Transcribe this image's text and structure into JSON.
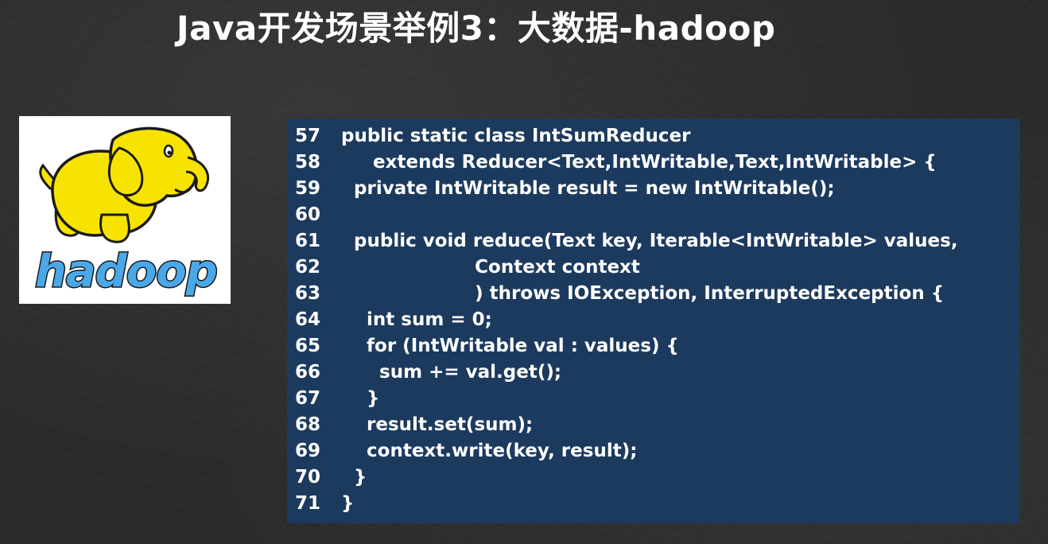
{
  "slide": {
    "title": "Java开发场景举例3：大数据-hadoop"
  },
  "logo": {
    "wordmark": "hadoop",
    "icon": "hadoop-elephant-icon",
    "colors": {
      "elephant_yellow": "#f6e400",
      "wordmark_blue": "#4aa8e8",
      "outline": "#1a1a1a"
    }
  },
  "code": {
    "lines": [
      {
        "num": "57",
        "text": "public static class IntSumReducer"
      },
      {
        "num": "58",
        "text": "     extends Reducer<Text,IntWritable,Text,IntWritable> {"
      },
      {
        "num": "59",
        "text": "  private IntWritable result = new IntWritable();"
      },
      {
        "num": "60",
        "text": ""
      },
      {
        "num": "61",
        "text": "  public void reduce(Text key, Iterable<IntWritable> values,"
      },
      {
        "num": "62",
        "text": "                     Context context"
      },
      {
        "num": "63",
        "text": "                     ) throws IOException, InterruptedException {"
      },
      {
        "num": "64",
        "text": "    int sum = 0;"
      },
      {
        "num": "65",
        "text": "    for (IntWritable val : values) {"
      },
      {
        "num": "66",
        "text": "      sum += val.get();"
      },
      {
        "num": "67",
        "text": "    }"
      },
      {
        "num": "68",
        "text": "    result.set(sum);"
      },
      {
        "num": "69",
        "text": "    context.write(key, result);"
      },
      {
        "num": "70",
        "text": "  }"
      },
      {
        "num": "71",
        "text": "}"
      }
    ]
  },
  "colors": {
    "background": "#2b2b2b",
    "code_background": "#1c3a5e",
    "text": "#ffffff"
  }
}
